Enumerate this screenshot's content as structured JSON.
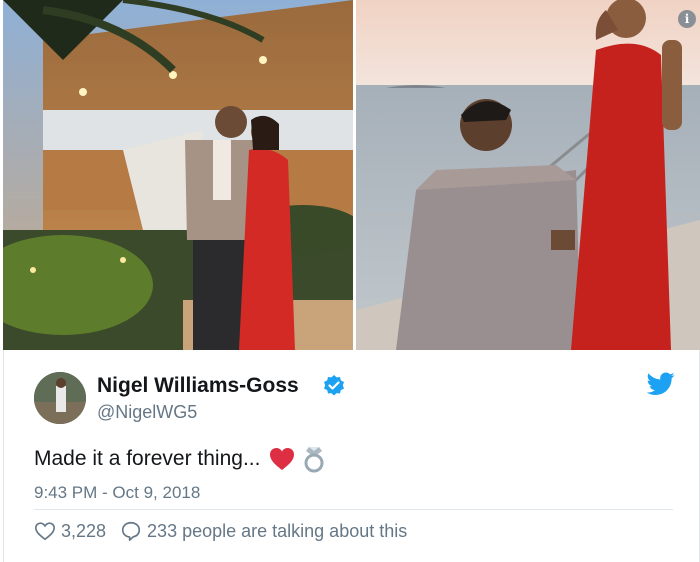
{
  "tweet": {
    "author_name": "Nigel Williams-Goss",
    "handle": "@NigelWG5",
    "text": "Made it a forever thing...",
    "emojis": [
      "red-heart",
      "ring"
    ],
    "timestamp": "9:43 PM - Oct 9, 2018",
    "likes": "3,228",
    "talking": "233 people are talking about this",
    "verified": true
  },
  "media": {
    "info_badge": "i",
    "photos": [
      "couple-posing-at-night",
      "proposal-on-dock-at-sunset"
    ]
  },
  "colors": {
    "accent": "#1da1f2",
    "heart": "#e0245e",
    "dress": "#d42a26",
    "secondary_text": "#657786"
  }
}
